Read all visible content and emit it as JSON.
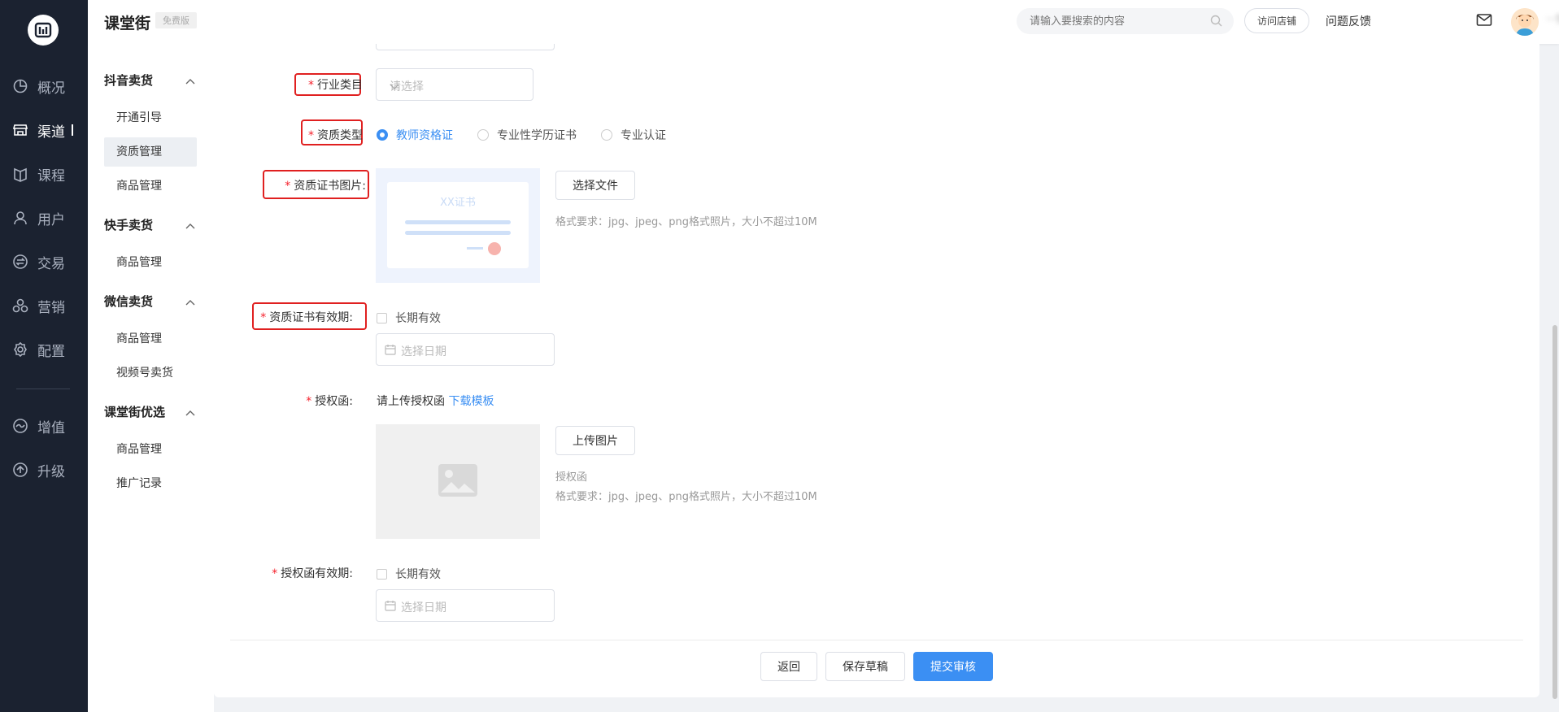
{
  "rail": {
    "items": [
      {
        "label": "概况",
        "icon": "pie-chart-icon"
      },
      {
        "label": "渠道",
        "icon": "store-icon"
      },
      {
        "label": "课程",
        "icon": "book-icon"
      },
      {
        "label": "用户",
        "icon": "user-icon"
      },
      {
        "label": "交易",
        "icon": "exchange-icon"
      },
      {
        "label": "营销",
        "icon": "marketing-icon"
      },
      {
        "label": "配置",
        "icon": "gear-icon"
      },
      {
        "label": "增值",
        "icon": "value-add-icon"
      },
      {
        "label": "升级",
        "icon": "upgrade-icon"
      }
    ],
    "active": "渠道"
  },
  "header": {
    "brand": "课堂街",
    "badge": "免费版",
    "search_placeholder": "请输入要搜索的内容",
    "visit_store": "访问店铺",
    "feedback": "问题反馈",
    "username": "···5"
  },
  "subnav": {
    "groups": [
      {
        "title": "抖音卖货",
        "items": [
          "开通引导",
          "资质管理",
          "商品管理"
        ]
      },
      {
        "title": "快手卖货",
        "items": [
          "商品管理"
        ]
      },
      {
        "title": "微信卖货",
        "items": [
          "商品管理",
          "视频号卖货"
        ]
      },
      {
        "title": "课堂街优选",
        "items": [
          "商品管理",
          "推广记录"
        ]
      }
    ],
    "active_item": "资质管理"
  },
  "form": {
    "industry_label": "行业类目",
    "industry_placeholder": "请选择",
    "qual_type_label": "资质类型",
    "qual_types": [
      "教师资格证",
      "专业性学历证书",
      "专业认证"
    ],
    "qual_type_selected": "教师资格证",
    "cert_image_label": "资质证书图片:",
    "cert_sample_text": "XX证书",
    "choose_file": "选择文件",
    "format_hint": "格式要求：jpg、jpeg、png格式照片，大小不超过10M",
    "cert_validity_label": "资质证书有效期:",
    "long_term": "长期有效",
    "date_placeholder": "选择日期",
    "auth_label": "授权函:",
    "auth_text": "请上传授权函",
    "download_template": "下载模板",
    "upload_image": "上传图片",
    "auth_caption": "授权函",
    "auth_validity_label": "授权函有效期:"
  },
  "footer": {
    "back": "返回",
    "save_draft": "保存草稿",
    "submit": "提交审核"
  },
  "colors": {
    "accent": "#3b8ff3",
    "rail_bg": "#1b2230",
    "highlight": "#e02020",
    "required": "#f5222d"
  }
}
